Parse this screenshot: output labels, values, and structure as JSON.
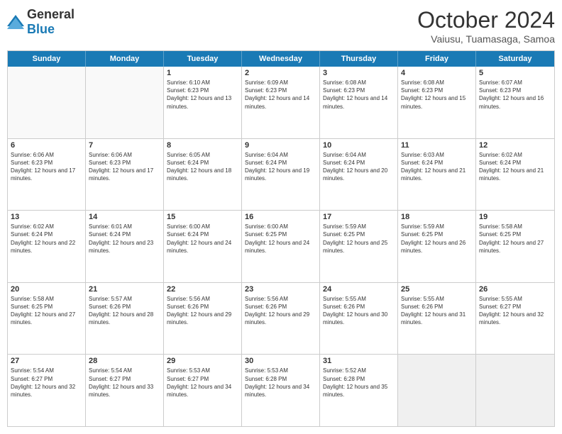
{
  "logo": {
    "general": "General",
    "blue": "Blue"
  },
  "title": "October 2024",
  "subtitle": "Vaiusu, Tuamasaga, Samoa",
  "days": [
    "Sunday",
    "Monday",
    "Tuesday",
    "Wednesday",
    "Thursday",
    "Friday",
    "Saturday"
  ],
  "weeks": [
    [
      {
        "day": "",
        "text": "",
        "empty": true
      },
      {
        "day": "",
        "text": "",
        "empty": true
      },
      {
        "day": "1",
        "text": "Sunrise: 6:10 AM\nSunset: 6:23 PM\nDaylight: 12 hours and 13 minutes."
      },
      {
        "day": "2",
        "text": "Sunrise: 6:09 AM\nSunset: 6:23 PM\nDaylight: 12 hours and 14 minutes."
      },
      {
        "day": "3",
        "text": "Sunrise: 6:08 AM\nSunset: 6:23 PM\nDaylight: 12 hours and 14 minutes."
      },
      {
        "day": "4",
        "text": "Sunrise: 6:08 AM\nSunset: 6:23 PM\nDaylight: 12 hours and 15 minutes."
      },
      {
        "day": "5",
        "text": "Sunrise: 6:07 AM\nSunset: 6:23 PM\nDaylight: 12 hours and 16 minutes."
      }
    ],
    [
      {
        "day": "6",
        "text": "Sunrise: 6:06 AM\nSunset: 6:23 PM\nDaylight: 12 hours and 17 minutes."
      },
      {
        "day": "7",
        "text": "Sunrise: 6:06 AM\nSunset: 6:23 PM\nDaylight: 12 hours and 17 minutes."
      },
      {
        "day": "8",
        "text": "Sunrise: 6:05 AM\nSunset: 6:24 PM\nDaylight: 12 hours and 18 minutes."
      },
      {
        "day": "9",
        "text": "Sunrise: 6:04 AM\nSunset: 6:24 PM\nDaylight: 12 hours and 19 minutes."
      },
      {
        "day": "10",
        "text": "Sunrise: 6:04 AM\nSunset: 6:24 PM\nDaylight: 12 hours and 20 minutes."
      },
      {
        "day": "11",
        "text": "Sunrise: 6:03 AM\nSunset: 6:24 PM\nDaylight: 12 hours and 21 minutes."
      },
      {
        "day": "12",
        "text": "Sunrise: 6:02 AM\nSunset: 6:24 PM\nDaylight: 12 hours and 21 minutes."
      }
    ],
    [
      {
        "day": "13",
        "text": "Sunrise: 6:02 AM\nSunset: 6:24 PM\nDaylight: 12 hours and 22 minutes."
      },
      {
        "day": "14",
        "text": "Sunrise: 6:01 AM\nSunset: 6:24 PM\nDaylight: 12 hours and 23 minutes."
      },
      {
        "day": "15",
        "text": "Sunrise: 6:00 AM\nSunset: 6:24 PM\nDaylight: 12 hours and 24 minutes."
      },
      {
        "day": "16",
        "text": "Sunrise: 6:00 AM\nSunset: 6:25 PM\nDaylight: 12 hours and 24 minutes."
      },
      {
        "day": "17",
        "text": "Sunrise: 5:59 AM\nSunset: 6:25 PM\nDaylight: 12 hours and 25 minutes."
      },
      {
        "day": "18",
        "text": "Sunrise: 5:59 AM\nSunset: 6:25 PM\nDaylight: 12 hours and 26 minutes."
      },
      {
        "day": "19",
        "text": "Sunrise: 5:58 AM\nSunset: 6:25 PM\nDaylight: 12 hours and 27 minutes."
      }
    ],
    [
      {
        "day": "20",
        "text": "Sunrise: 5:58 AM\nSunset: 6:25 PM\nDaylight: 12 hours and 27 minutes."
      },
      {
        "day": "21",
        "text": "Sunrise: 5:57 AM\nSunset: 6:26 PM\nDaylight: 12 hours and 28 minutes."
      },
      {
        "day": "22",
        "text": "Sunrise: 5:56 AM\nSunset: 6:26 PM\nDaylight: 12 hours and 29 minutes."
      },
      {
        "day": "23",
        "text": "Sunrise: 5:56 AM\nSunset: 6:26 PM\nDaylight: 12 hours and 29 minutes."
      },
      {
        "day": "24",
        "text": "Sunrise: 5:55 AM\nSunset: 6:26 PM\nDaylight: 12 hours and 30 minutes."
      },
      {
        "day": "25",
        "text": "Sunrise: 5:55 AM\nSunset: 6:26 PM\nDaylight: 12 hours and 31 minutes."
      },
      {
        "day": "26",
        "text": "Sunrise: 5:55 AM\nSunset: 6:27 PM\nDaylight: 12 hours and 32 minutes."
      }
    ],
    [
      {
        "day": "27",
        "text": "Sunrise: 5:54 AM\nSunset: 6:27 PM\nDaylight: 12 hours and 32 minutes."
      },
      {
        "day": "28",
        "text": "Sunrise: 5:54 AM\nSunset: 6:27 PM\nDaylight: 12 hours and 33 minutes."
      },
      {
        "day": "29",
        "text": "Sunrise: 5:53 AM\nSunset: 6:27 PM\nDaylight: 12 hours and 34 minutes."
      },
      {
        "day": "30",
        "text": "Sunrise: 5:53 AM\nSunset: 6:28 PM\nDaylight: 12 hours and 34 minutes."
      },
      {
        "day": "31",
        "text": "Sunrise: 5:52 AM\nSunset: 6:28 PM\nDaylight: 12 hours and 35 minutes."
      },
      {
        "day": "",
        "text": "",
        "empty": true,
        "shaded": true
      },
      {
        "day": "",
        "text": "",
        "empty": true,
        "shaded": true
      }
    ]
  ]
}
